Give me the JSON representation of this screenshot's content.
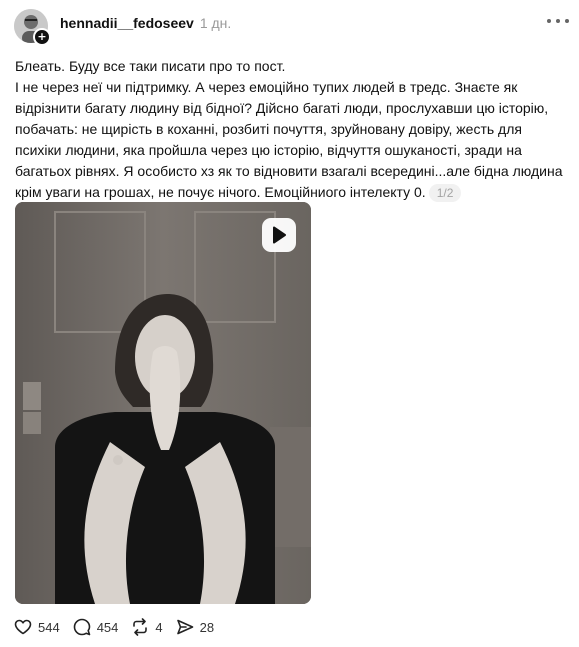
{
  "post": {
    "author": {
      "username": "hennadii__fedoseev",
      "avatar_icon": "avatar-photo-icon",
      "follow_badge": "+"
    },
    "timestamp": "1 дн.",
    "text_lines": [
      "Блеать. Буду все таки писати про то пост.",
      "І не через неї чи підтримку. А через емоційно тупих людей в тредс. Знаєте як відрізнити багату людину від бідної? Дійсно багаті люди, прослухавши цю історію, побачать: не щирість в коханні, розбиті почуття, зруйновану довіру, жесть для психіки людини, яка пройшла через цю історію, відчуття ошуканості, зради на багатьох рівнях. Я особисто хз як то відновити взагалі всередині...але бідна людина крім уваги на грошах, не почує нічого. Емоційниого інтелекту 0."
    ],
    "page_indicator": "1/2",
    "media": {
      "type": "video",
      "play_icon": "play-icon"
    },
    "actions": {
      "likes": "544",
      "replies": "454",
      "reposts": "4",
      "shares": "28"
    }
  },
  "colors": {
    "text": "#111111",
    "muted": "#9a9a9a",
    "indicator_bg": "#f1f1f1"
  }
}
